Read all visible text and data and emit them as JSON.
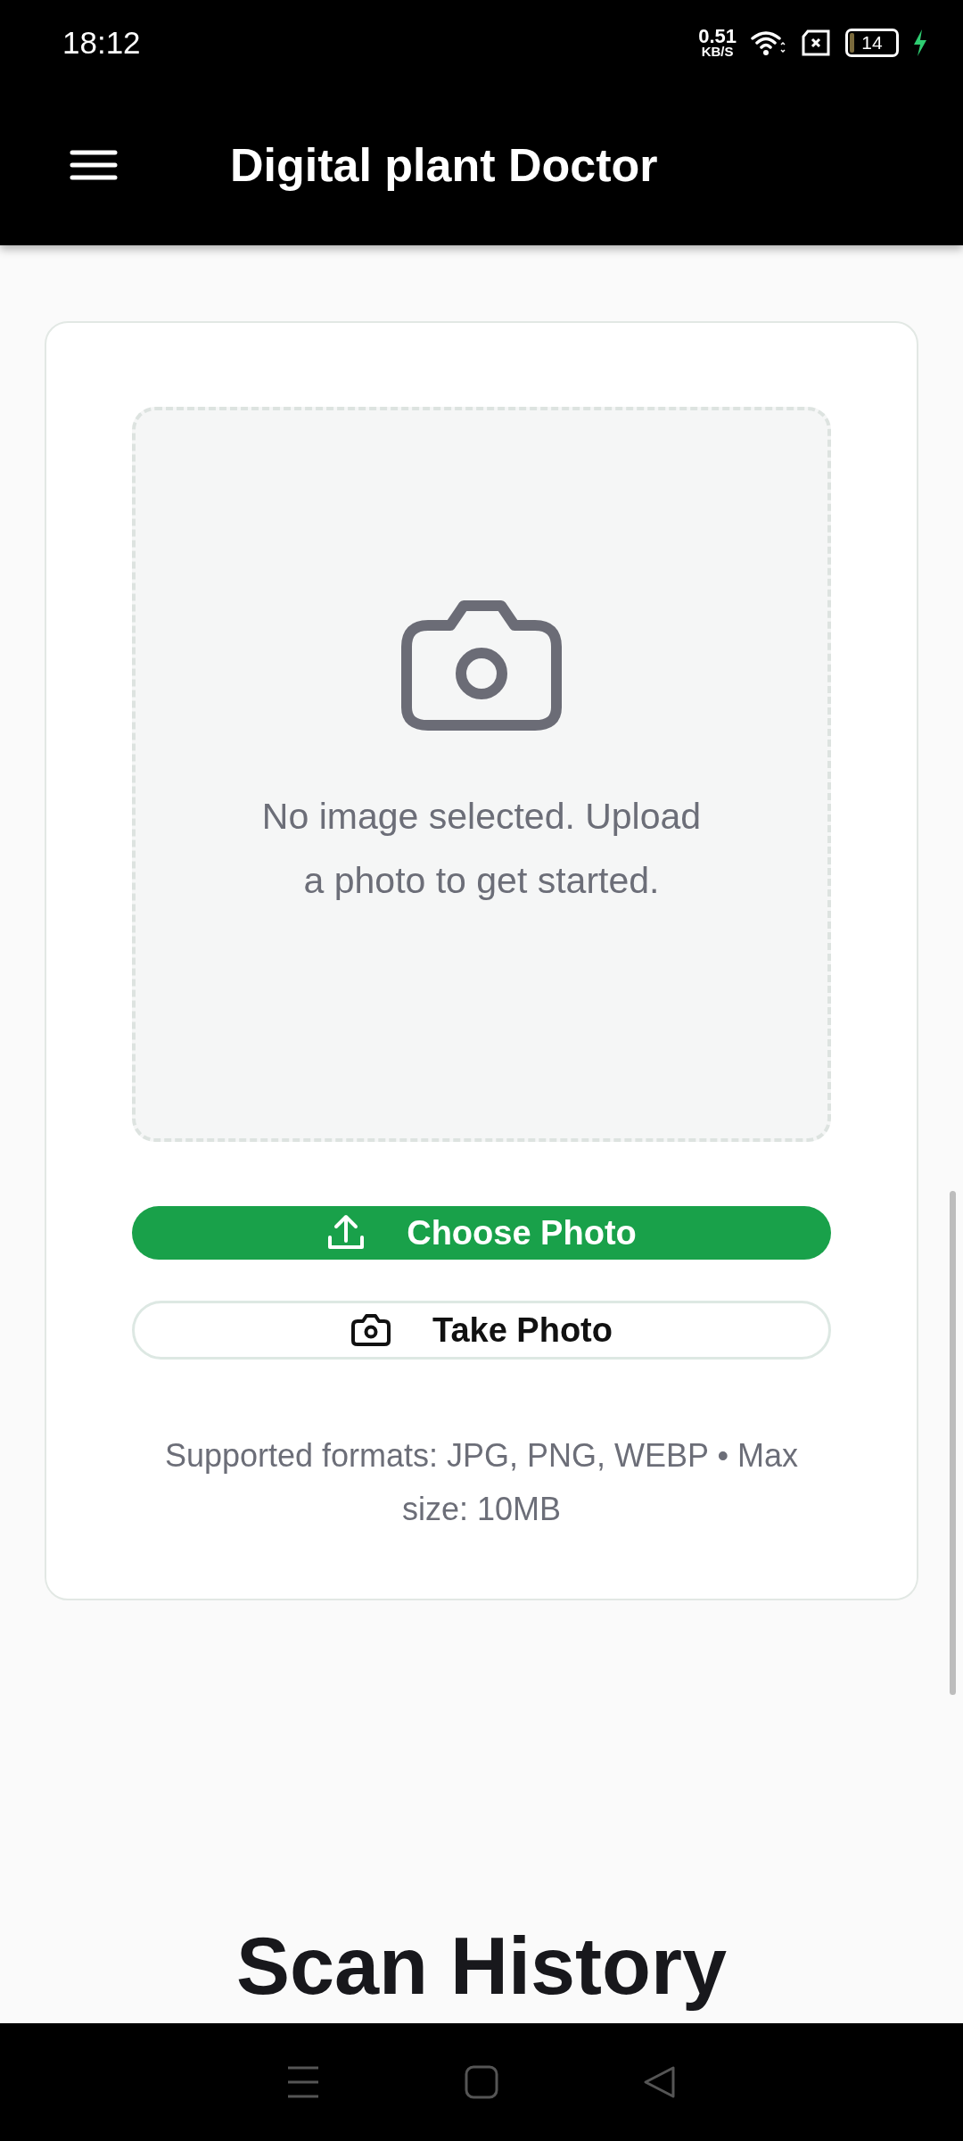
{
  "status_bar": {
    "time": "18:12",
    "net_speed": "0.51",
    "net_unit": "KB/S",
    "battery": "14"
  },
  "app_bar": {
    "title": "Digital plant Doctor"
  },
  "upload_card": {
    "empty_message": "No image selected. Upload a photo to get started.",
    "buttons": [
      {
        "kind": "primary",
        "label": "Choose Photo"
      },
      {
        "kind": "outline",
        "label": "Take Photo"
      }
    ],
    "hint": "Supported formats: JPG, PNG, WEBP • Max size: 10MB"
  },
  "section_title": "Scan History"
}
